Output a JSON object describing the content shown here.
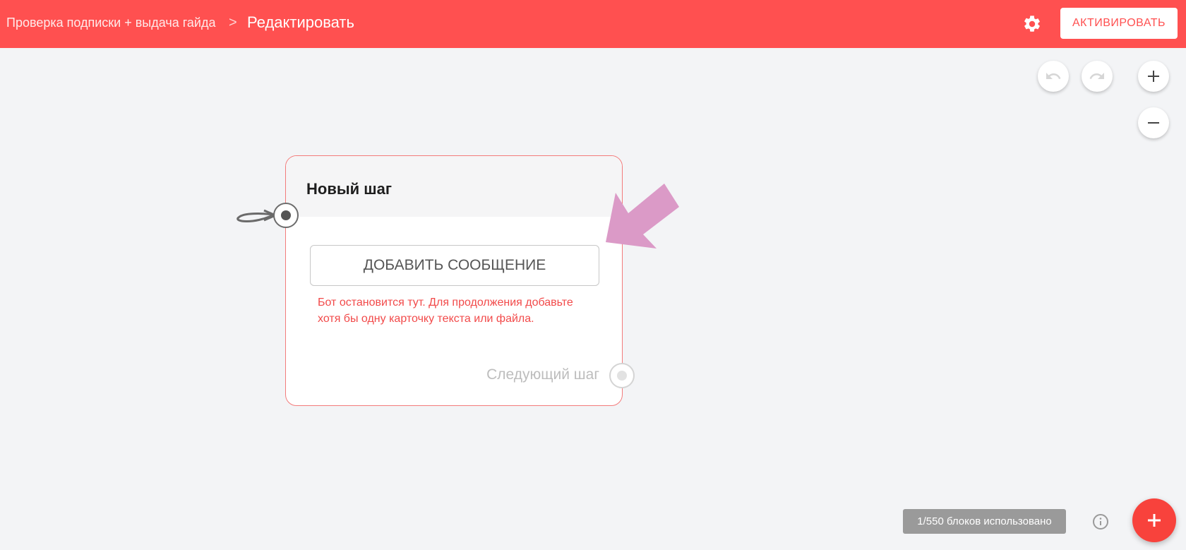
{
  "header": {
    "breadcrumb_root": "Проверка подписки + выдача гайда",
    "breadcrumb_separator": ">",
    "breadcrumb_current": "Редактировать",
    "activate_label": "АКТИВИРОВАТЬ",
    "background_color": "#ff5050"
  },
  "toolbar": {
    "undo_icon": "undo-icon",
    "redo_icon": "redo-icon",
    "zoom_in_icon": "plus-icon",
    "zoom_out_icon": "minus-icon"
  },
  "step_card": {
    "title": "Новый шаг",
    "add_message_label": "ДОБАВИТЬ СООБЩЕНИЕ",
    "warning_text": "Бот остановится тут. Для продолжения добавьте хотя бы одну карточку текста или файла.",
    "next_step_label": "Следующий шаг",
    "border_color": "#f37b7b",
    "warning_color": "#f24a4a"
  },
  "footer": {
    "usage_text": "1/550 блоков использовано",
    "fab_icon": "plus-icon",
    "info_icon": "info-icon"
  },
  "annotation": {
    "arrow_color": "#db9ac7"
  }
}
